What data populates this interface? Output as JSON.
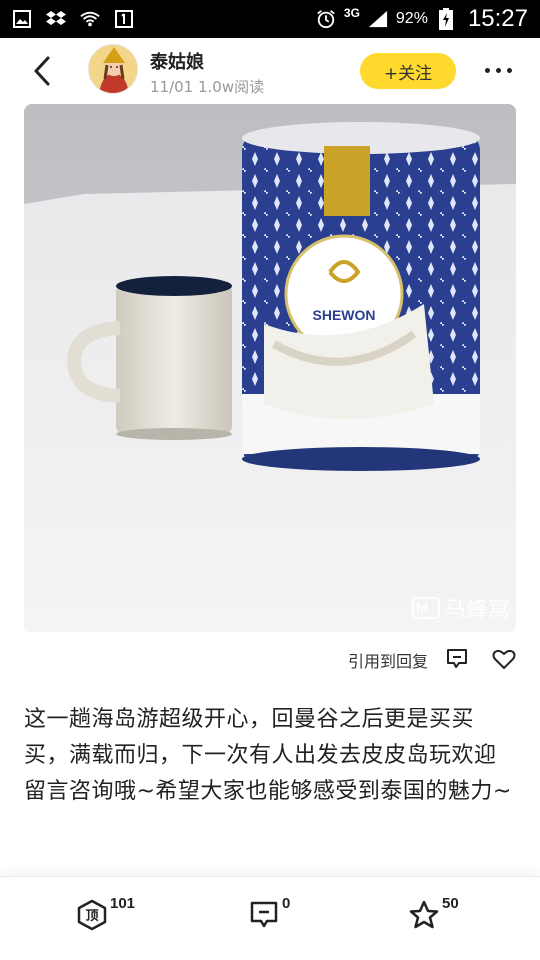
{
  "statusbar": {
    "network": "3G",
    "battery": "92%",
    "time": "15:27",
    "icons": [
      "image-icon",
      "dropbox-icon",
      "wifi-question-icon",
      "notification-1-icon",
      "alarm-icon",
      "signal-icon",
      "battery-charging-icon"
    ]
  },
  "header": {
    "author": "泰姑娘",
    "meta": "11/01 1.0w阅读",
    "follow_label": "+关注"
  },
  "photo": {
    "watermark": "马蜂窝",
    "brand": "SHEWON"
  },
  "actions": {
    "quote_label": "引用到回复"
  },
  "body": {
    "text": "这一趟海岛游超级开心，回曼谷之后更是买买买，满载而归，下一次有人出发去皮皮岛玩欢迎留言咨询哦~希望大家也能够感受到泰国的魅力~"
  },
  "bottombar": {
    "top_count": "101",
    "comment_count": "0",
    "star_count": "50"
  },
  "colors": {
    "accent": "#ffd92c",
    "text": "#222222",
    "muted": "#999999"
  }
}
